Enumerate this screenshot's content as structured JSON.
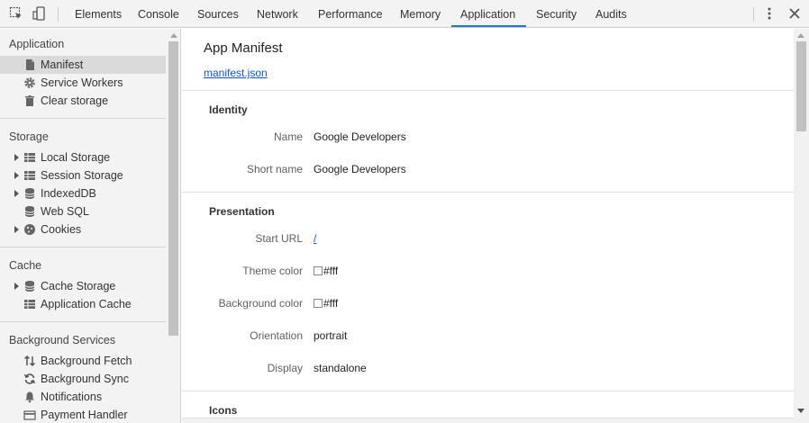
{
  "toolbar": {
    "tabs": [
      {
        "label": "Elements"
      },
      {
        "label": "Console"
      },
      {
        "label": "Sources"
      },
      {
        "label": "Network"
      },
      {
        "label": "Performance"
      },
      {
        "label": "Memory"
      },
      {
        "label": "Application"
      },
      {
        "label": "Security"
      },
      {
        "label": "Audits"
      }
    ],
    "active_tab": "Application",
    "accent_color": "#1a73e8",
    "icons": [
      "inspect-element-icon",
      "device-toolbar-icon",
      "more-options-icon",
      "close-icon"
    ]
  },
  "sidebar": {
    "sections": [
      {
        "header": "Application",
        "items": [
          {
            "label": "Manifest",
            "icon": "document-icon",
            "selected": true
          },
          {
            "label": "Service Workers",
            "icon": "gear-icon"
          },
          {
            "label": "Clear storage",
            "icon": "trash-icon"
          }
        ]
      },
      {
        "header": "Storage",
        "items": [
          {
            "label": "Local Storage",
            "icon": "grid-icon",
            "expandable": true
          },
          {
            "label": "Session Storage",
            "icon": "grid-icon",
            "expandable": true
          },
          {
            "label": "IndexedDB",
            "icon": "database-icon",
            "expandable": true
          },
          {
            "label": "Web SQL",
            "icon": "database-icon"
          },
          {
            "label": "Cookies",
            "icon": "cookie-icon",
            "expandable": true
          }
        ]
      },
      {
        "header": "Cache",
        "items": [
          {
            "label": "Cache Storage",
            "icon": "database-icon",
            "expandable": true
          },
          {
            "label": "Application Cache",
            "icon": "grid-icon"
          }
        ]
      },
      {
        "header": "Background Services",
        "items": [
          {
            "label": "Background Fetch",
            "icon": "up-down-arrows-icon"
          },
          {
            "label": "Background Sync",
            "icon": "sync-icon"
          },
          {
            "label": "Notifications",
            "icon": "bell-icon"
          },
          {
            "label": "Payment Handler",
            "icon": "card-icon"
          }
        ]
      }
    ]
  },
  "main": {
    "title": "App Manifest",
    "manifest_link": "manifest.json",
    "identity": {
      "title": "Identity",
      "rows": [
        {
          "label": "Name",
          "value": "Google Developers"
        },
        {
          "label": "Short name",
          "value": "Google Developers"
        }
      ]
    },
    "presentation": {
      "title": "Presentation",
      "start_url": {
        "label": "Start URL",
        "value": "/"
      },
      "theme_color": {
        "label": "Theme color",
        "value": "#fff",
        "swatch": "#ffffff"
      },
      "background_color": {
        "label": "Background color",
        "value": "#fff",
        "swatch": "#ffffff"
      },
      "orientation": {
        "label": "Orientation",
        "value": "portrait"
      },
      "display": {
        "label": "Display",
        "value": "standalone"
      }
    },
    "icons": {
      "title": "Icons"
    }
  }
}
